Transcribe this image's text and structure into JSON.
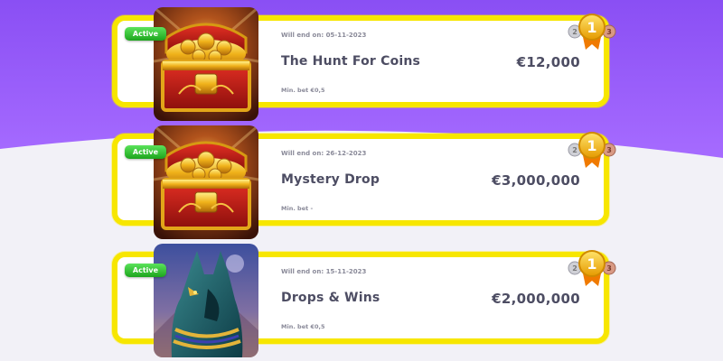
{
  "cards": [
    {
      "status": "Active",
      "end_date": "Will end on: 05-11-2023",
      "title": "The Hunt For Coins",
      "amount": "€12,000",
      "min_bet": "Min. bet €0,5",
      "thumb_icon": "treasure-chest",
      "medal_icon": "rank-medals",
      "medal_rank": "1"
    },
    {
      "status": "Active",
      "end_date": "Will end on: 26-12-2023",
      "title": "Mystery Drop",
      "amount": "€3,000,000",
      "min_bet": "Min. bet -",
      "thumb_icon": "treasure-chest",
      "medal_icon": "rank-medals",
      "medal_rank": "1"
    },
    {
      "status": "Active",
      "end_date": "Will end on: 15-11-2023",
      "title": "Drops & Wins",
      "amount": "€2,000,000",
      "min_bet": "Min. bet €0,5",
      "thumb_icon": "anubis-head",
      "medal_icon": "rank-medals",
      "medal_rank": "1"
    }
  ],
  "colors": {
    "header_purple": "#8a55f5",
    "card_border": "#f7e600",
    "active_green": "#2fbf2f",
    "text_dark": "#4d4d63"
  }
}
